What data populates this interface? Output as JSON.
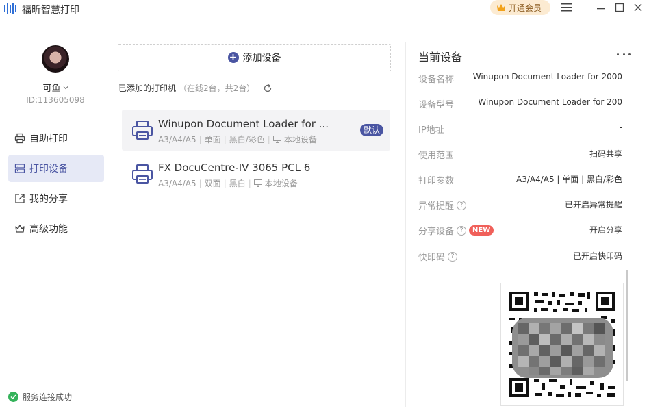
{
  "app": {
    "title": "福昕智慧打印",
    "vip_label": "开通会员"
  },
  "user": {
    "name": "可鱼",
    "id": "ID:113605098"
  },
  "nav": {
    "items": [
      {
        "label": "自助打印",
        "icon": "printer-icon",
        "active": false
      },
      {
        "label": "打印设备",
        "icon": "device-list-icon",
        "active": true
      },
      {
        "label": "我的分享",
        "icon": "share-icon",
        "active": false
      },
      {
        "label": "高级功能",
        "icon": "crown-outline-icon",
        "active": false
      }
    ]
  },
  "status": {
    "text": "服务连接成功",
    "color": "#34b25a"
  },
  "devices": {
    "add_label": "添加设备",
    "heading": "已添加的打印机",
    "count_text": "（在线2台，共2台）",
    "list": [
      {
        "name": "Winupon Document Loader for ...",
        "paper": "A3/A4/A5",
        "duplex": "单面",
        "color_mode": "黑白/彩色",
        "location": "本地设备",
        "badge": "默认",
        "selected": true
      },
      {
        "name": "FX DocuCentre-IV 3065 PCL 6",
        "paper": "A3/A4/A5",
        "duplex": "双面",
        "color_mode": "黑白",
        "location": "本地设备",
        "badge": "",
        "selected": false
      }
    ]
  },
  "current_device": {
    "title": "当前设备",
    "fields": [
      {
        "key": "设备名称",
        "value": "Winupon Document Loader for 2000",
        "help": false,
        "new": false
      },
      {
        "key": "设备型号",
        "value": "Winupon Document Loader for 200",
        "help": false,
        "new": false
      },
      {
        "key": "IP地址",
        "value": "-",
        "help": false,
        "new": false
      },
      {
        "key": "使用范围",
        "value": "扫码共享",
        "help": false,
        "new": false
      },
      {
        "key": "打印参数",
        "value": "A3/A4/A5 | 单面 | 黑白/彩色",
        "help": false,
        "new": false
      },
      {
        "key": "异常提醒",
        "value": "已开启异常提醒",
        "help": true,
        "new": false
      },
      {
        "key": "分享设备",
        "value": "开启分享",
        "help": true,
        "new": true
      },
      {
        "key": "快印码",
        "value": "已开启快印码",
        "help": true,
        "new": false
      }
    ],
    "new_badge": "NEW",
    "help_glyph": "?"
  },
  "colors": {
    "accent": "#4a55a2",
    "active_bg": "#e6e9f6",
    "vip_bg": "#fcebd2",
    "new_badge": "#f0605a"
  }
}
